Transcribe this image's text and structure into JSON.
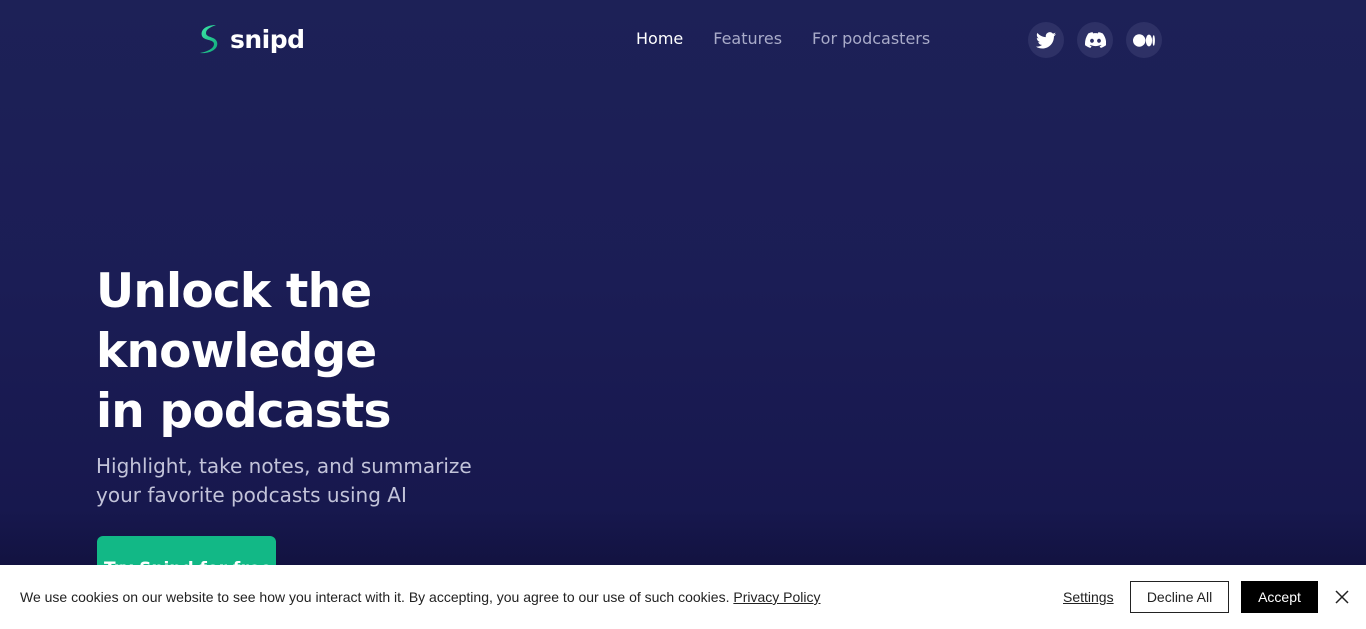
{
  "brand": {
    "name": "snipd",
    "accent": "#12b886"
  },
  "nav": {
    "items": [
      {
        "label": "Home",
        "active": true
      },
      {
        "label": "Features",
        "active": false
      },
      {
        "label": "For podcasters",
        "active": false
      }
    ]
  },
  "social": [
    {
      "icon": "twitter-icon"
    },
    {
      "icon": "discord-icon"
    },
    {
      "icon": "medium-icon"
    }
  ],
  "hero": {
    "title_lines": [
      "Unlock the",
      "knowledge",
      "in podcasts"
    ],
    "subtitle": "Highlight, take notes, and summarize your favorite podcasts using AI",
    "cta_label": "Try Snipd for free"
  },
  "cookie_banner": {
    "text": "We use cookies on our website to see how you interact with it. By accepting, you agree to our use of such cookies.",
    "privacy_link": "Privacy Policy",
    "settings_label": "Settings",
    "decline_label": "Decline All",
    "accept_label": "Accept"
  }
}
